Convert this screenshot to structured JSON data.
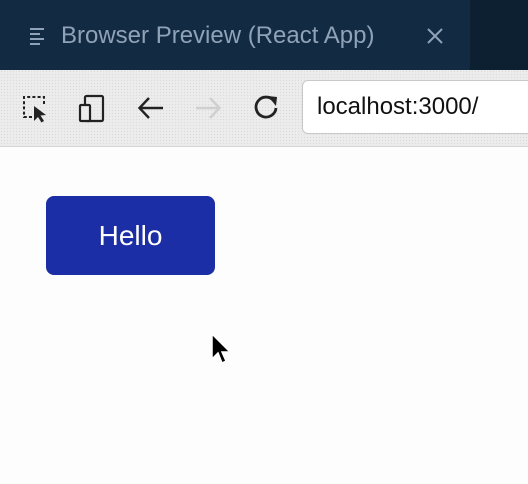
{
  "tab": {
    "title": "Browser Preview (React App)",
    "icon": "list-lines-icon",
    "close_icon": "close-icon"
  },
  "toolbar": {
    "tools": [
      "inspect-element-icon",
      "device-toggle-icon",
      "back-arrow-icon",
      "forward-arrow-icon",
      "reload-icon"
    ],
    "forward_enabled": false,
    "url": "localhost:3000/"
  },
  "page": {
    "button_label": "Hello",
    "button_color": "#1b2ea6"
  },
  "colors": {
    "tabbar_bg": "#0c2032",
    "tab_bg": "#122b42",
    "tab_text": "#8fa2b7",
    "toolbar_bg": "#ececec"
  }
}
